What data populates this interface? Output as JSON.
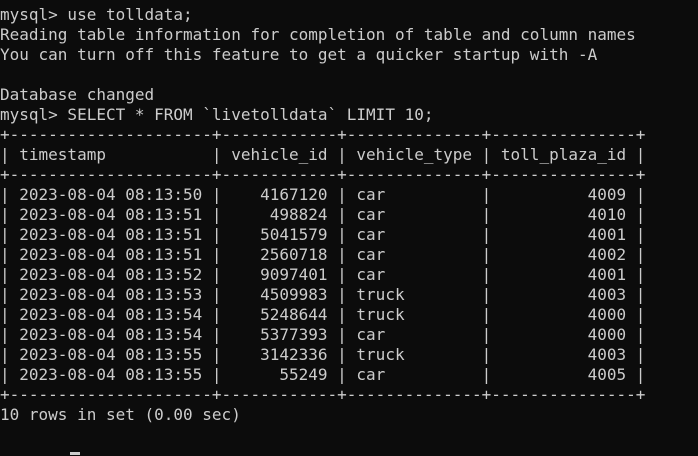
{
  "terminal": {
    "lines": [
      "mysql> use tolldata;",
      "Reading table information for completion of table and column names",
      "You can turn off this feature to get a quicker startup with -A",
      "",
      "Database changed",
      "mysql> SELECT * FROM `livetolldata` LIMIT 10;",
      "+---------------------+------------+--------------+---------------+",
      "| timestamp           | vehicle_id | vehicle_type | toll_plaza_id |",
      "+---------------------+------------+--------------+---------------+",
      "| 2023-08-04 08:13:50 |    4167120 | car          |          4009 |",
      "| 2023-08-04 08:13:51 |     498824 | car          |          4010 |",
      "| 2023-08-04 08:13:51 |    5041579 | car          |          4001 |",
      "| 2023-08-04 08:13:51 |    2560718 | car          |          4002 |",
      "| 2023-08-04 08:13:52 |    9097401 | car          |          4001 |",
      "| 2023-08-04 08:13:53 |    4509983 | truck        |          4003 |",
      "| 2023-08-04 08:13:54 |    5248644 | truck        |          4000 |",
      "| 2023-08-04 08:13:54 |    5377393 | car          |          4000 |",
      "| 2023-08-04 08:13:55 |    3142336 | truck        |          4003 |",
      "| 2023-08-04 08:13:55 |      55249 | car          |          4005 |",
      "+---------------------+------------+--------------+---------------+",
      "10 rows in set (0.00 sec)"
    ],
    "colors": {
      "background": "#0c0c0c",
      "foreground": "#cccccc"
    }
  }
}
